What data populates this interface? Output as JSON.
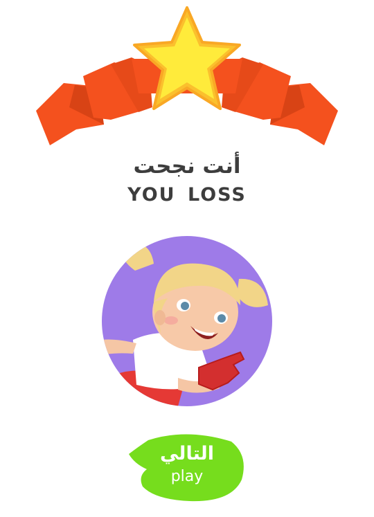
{
  "result": {
    "title_ar": "أنت نجحت",
    "title_en": "YOU  LOSS"
  },
  "play_button": {
    "label_ar": "التالي",
    "label_en": "play"
  },
  "colors": {
    "ribbon": "#f4511e",
    "ribbon_dark": "#d84315",
    "star": "#fdd835",
    "avatar_bg": "#9e7be8",
    "play_bg": "#76dd1d",
    "text": "#3d3d3d"
  },
  "icons": {
    "banner": "star-ribbon-icon",
    "avatar": "girl-character-avatar"
  }
}
